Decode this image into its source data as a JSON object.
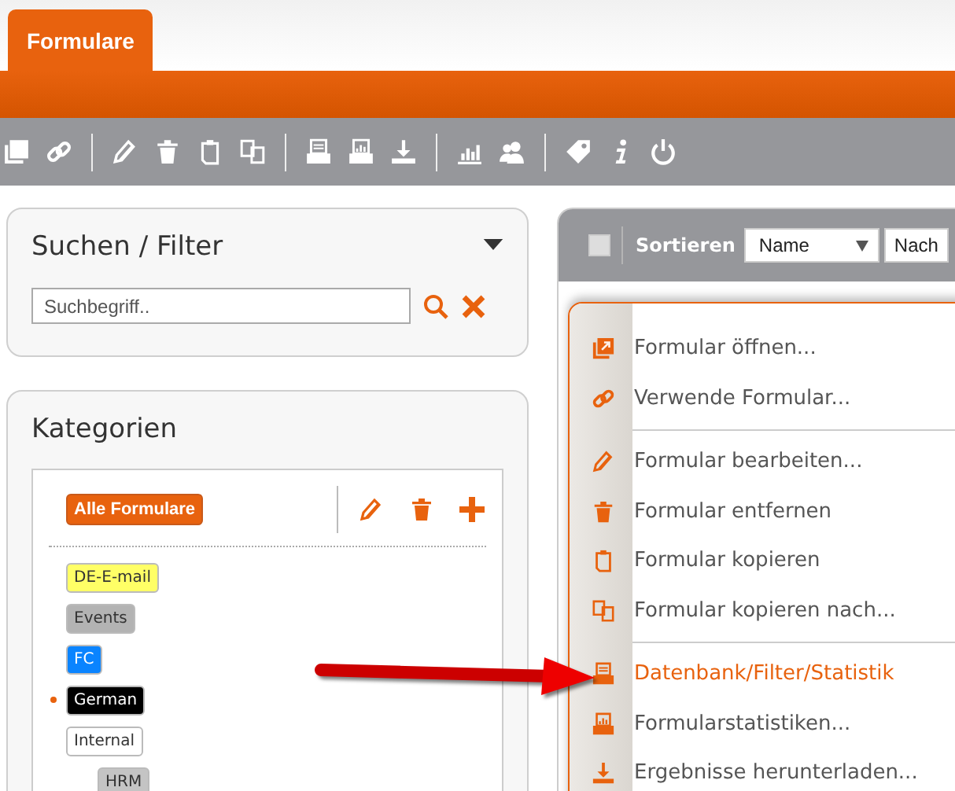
{
  "tabs": [
    {
      "label": "Formulare",
      "selected": true
    }
  ],
  "search_panel": {
    "title": "Suchen / Filter",
    "search_field": {
      "placeholder": "Suchbegriff.."
    }
  },
  "categories_panel": {
    "title": "Kategorien",
    "all_button": "Alle Formulare",
    "items": [
      {
        "label": "DE-E-mail",
        "color": "#ffff66",
        "selected": false
      },
      {
        "label": "Events",
        "color": "#b3b3b3",
        "selected": false
      },
      {
        "label": "FC",
        "color": "#0a84ff",
        "selected": false
      },
      {
        "label": "German",
        "color": "#000000",
        "selected": true
      },
      {
        "label": "Internal",
        "color": "#ffffff",
        "selected": false,
        "children": [
          {
            "label": "HRM",
            "color": "#c4c4c4",
            "selected": false
          }
        ]
      }
    ]
  },
  "list_panel": {
    "select_all_checked": false,
    "sort_label": "Sortieren",
    "sort_fields": [
      {
        "value": "Name"
      },
      {
        "value": "Nach"
      }
    ]
  },
  "context_menu": {
    "groups": [
      {
        "items": [
          {
            "label": "Formular öffnen...",
            "selected": false
          },
          {
            "label": "Verwende Formular...",
            "selected": false
          }
        ]
      },
      {
        "items": [
          {
            "label": "Formular bearbeiten...",
            "selected": false
          },
          {
            "label": "Formular entfernen",
            "selected": false
          },
          {
            "label": "Formular kopieren",
            "selected": false
          },
          {
            "label": "Formular kopieren nach...",
            "selected": false
          }
        ]
      },
      {
        "items": [
          {
            "label": "Datenbank/Filter/Statistik",
            "selected": true
          },
          {
            "label": "Formularstatistiken...",
            "selected": false
          },
          {
            "label": "Ergebnisse herunterladen...",
            "selected": false
          }
        ]
      }
    ]
  }
}
